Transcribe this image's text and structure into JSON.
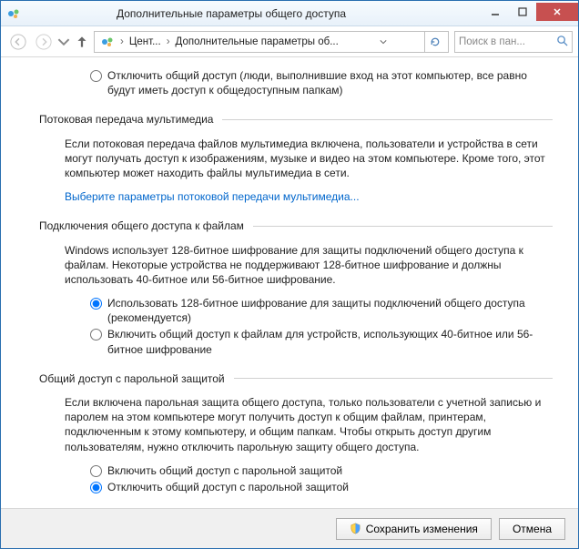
{
  "window": {
    "title": "Дополнительные параметры общего доступа"
  },
  "breadcrumb": {
    "seg1": "Цент...",
    "seg2": "Дополнительные параметры об..."
  },
  "search": {
    "placeholder": "Поиск в пан..."
  },
  "publicFolder": {
    "disable": "Отключить общий доступ (люди, выполнившие вход на этот компьютер, все равно будут иметь доступ к общедоступным папкам)"
  },
  "streaming": {
    "heading": "Потоковая передача мультимедиа",
    "para": "Если потоковая передача файлов мультимедиа включена, пользователи и устройства в сети могут получать доступ к изображениям, музыке и видео на этом компьютере. Кроме того, этот компьютер может находить файлы мультимедиа в сети.",
    "link": "Выберите параметры потоковой передачи мультимедиа..."
  },
  "encryption": {
    "heading": "Подключения общего доступа к файлам",
    "para": "Windows использует 128-битное шифрование для защиты подключений общего доступа к файлам. Некоторые устройства не поддерживают 128-битное шифрование и должны использовать 40-битное или 56-битное шифрование.",
    "opt128": "Использовать 128-битное шифрование для защиты подключений общего доступа (рекомендуется)",
    "opt40": "Включить общий доступ к файлам для устройств, использующих 40-битное или 56-битное шифрование"
  },
  "password": {
    "heading": "Общий доступ с парольной защитой",
    "para": "Если включена парольная защита общего доступа, только пользователи с учетной записью и паролем на этом компьютере могут получить доступ к общим файлам, принтерам, подключенным к этому компьютеру, и общим папкам. Чтобы открыть доступ другим пользователям, нужно отключить парольную защиту общего доступа.",
    "optOn": "Включить общий доступ с парольной защитой",
    "optOff": "Отключить общий доступ с парольной защитой"
  },
  "footer": {
    "save": "Сохранить изменения",
    "cancel": "Отмена"
  }
}
